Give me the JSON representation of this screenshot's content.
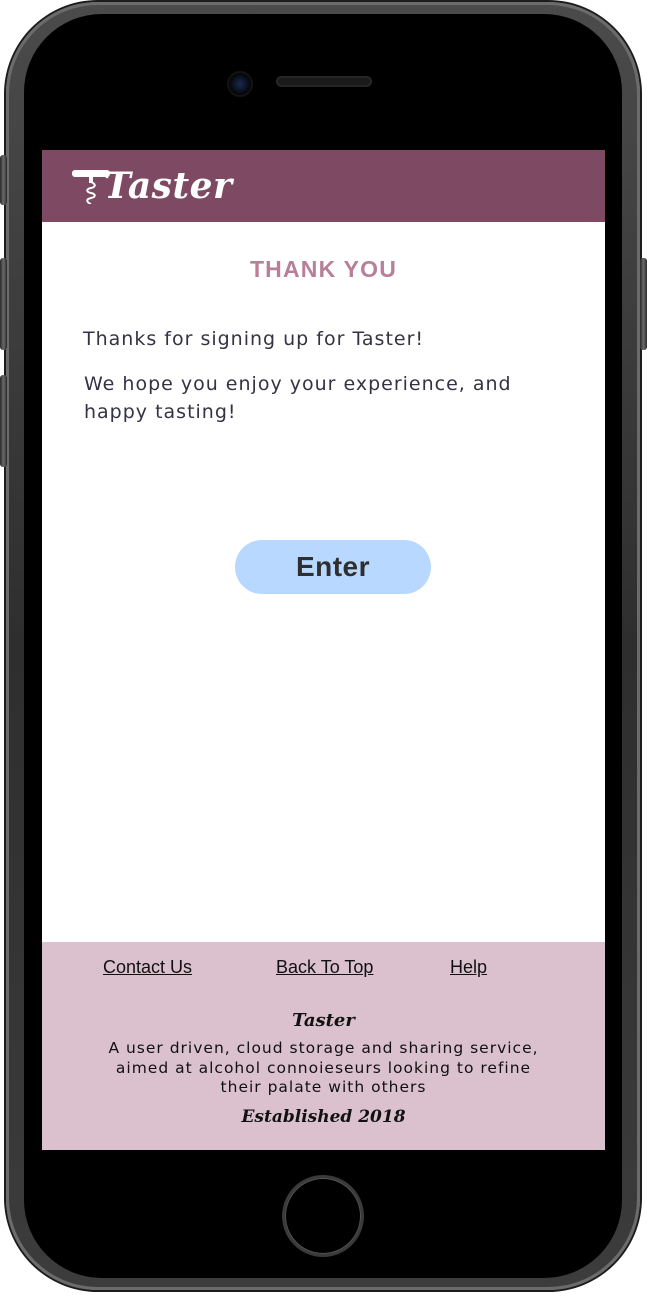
{
  "header": {
    "logo_text": "Taster"
  },
  "main": {
    "title": "THANK YOU",
    "message_line_1": "Thanks for signing up for Taster!",
    "message_line_2": "We hope you enjoy your experience, and happy tasting!",
    "enter_label": "Enter"
  },
  "footer": {
    "links": [
      {
        "label": "Contact Us"
      },
      {
        "label": "Back To Top"
      },
      {
        "label": "Help"
      }
    ],
    "brand": "Taster",
    "description": "A user driven, cloud storage and sharing service, aimed at alcohol connoieseurs looking to refine their palate with others",
    "established": "Established 2018"
  },
  "colors": {
    "header_bg": "#7e4a63",
    "title": "#b87f9a",
    "button_bg": "#b8d8ff",
    "footer_bg": "#dbc1ce"
  },
  "icons": {
    "logo_mark": "corkscrew-icon"
  }
}
